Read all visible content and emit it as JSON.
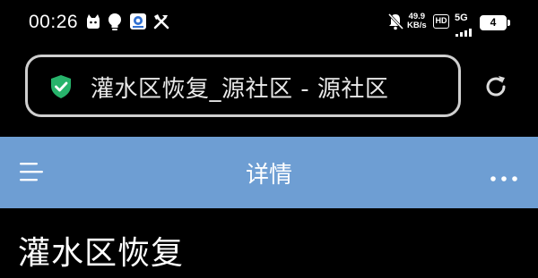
{
  "status_bar": {
    "time": "00:26",
    "net_speed_value": "49.9",
    "net_speed_unit": "KB/s",
    "hd_label": "HD",
    "network_label": "5G",
    "battery_level": "4",
    "icons": [
      "cat-app-icon",
      "lightbulb-icon",
      "camera-app-icon",
      "tools-icon",
      "bell-muted-icon",
      "signal-bars-icon",
      "battery-icon"
    ]
  },
  "address_bar": {
    "text": "灌水区恢复_源社区 - 源社区",
    "secure_icon": "shield-check-icon",
    "reload_icon": "reload-icon"
  },
  "header": {
    "title": "详情",
    "menu_icon": "menu-icon",
    "more_icon": "more-dots-icon",
    "background_color": "#6e9ed3"
  },
  "content": {
    "title": "灌水区恢复"
  }
}
